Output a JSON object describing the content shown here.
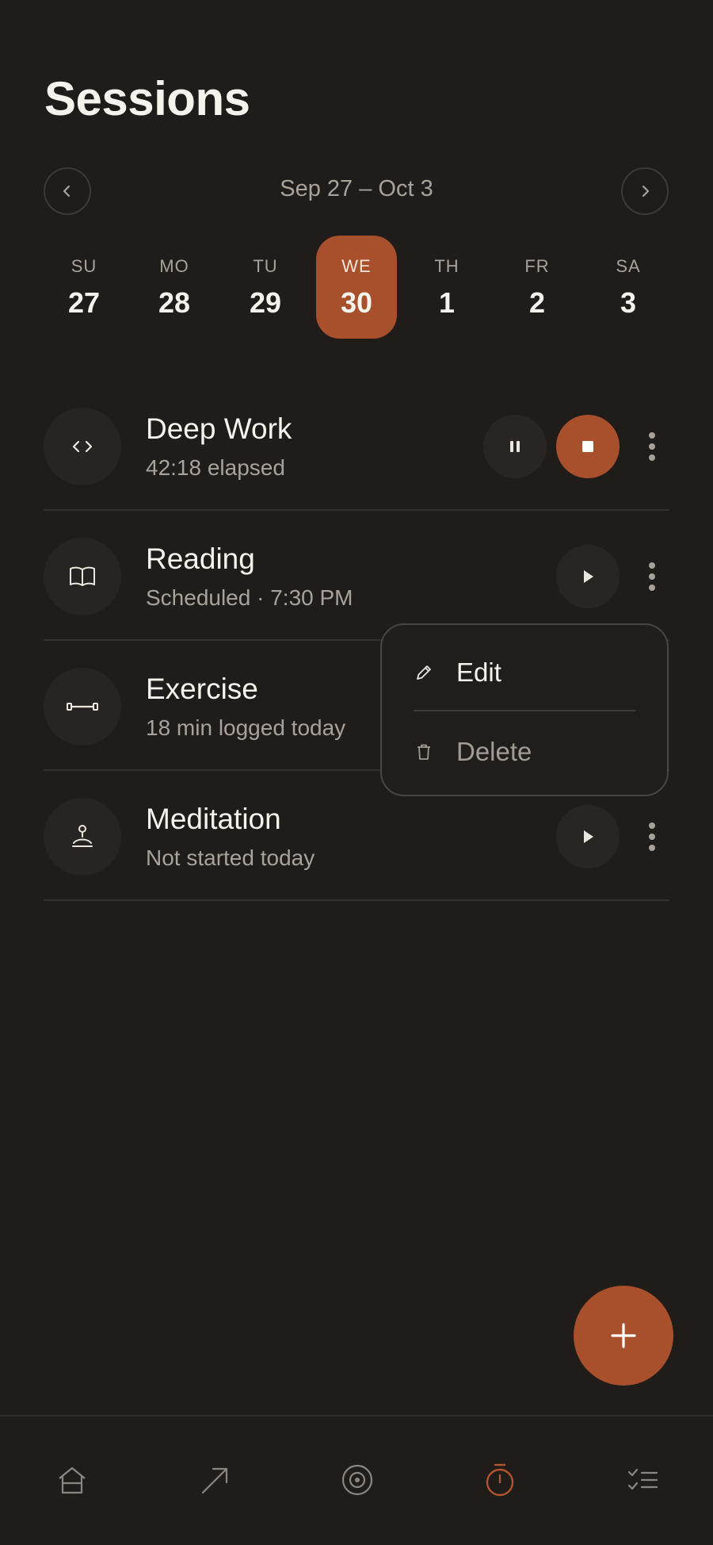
{
  "header": {
    "title": "Sessions"
  },
  "week_nav": {
    "range_label": "Sep 27 – Oct 3"
  },
  "week": {
    "days": [
      {
        "name": "SU",
        "date": "27"
      },
      {
        "name": "MO",
        "date": "28"
      },
      {
        "name": "TU",
        "date": "29"
      },
      {
        "name": "WE",
        "date": "30"
      },
      {
        "name": "TH",
        "date": "1"
      },
      {
        "name": "FR",
        "date": "2"
      },
      {
        "name": "SA",
        "date": "3"
      }
    ],
    "selected_day": "WE"
  },
  "sessions": [
    {
      "title": "Deep Work",
      "subtitle": "42:18 elapsed",
      "icon": "code-icon",
      "state": "running"
    },
    {
      "title": "Reading",
      "subtitle": "Scheduled · 7:30 PM",
      "icon": "book-icon",
      "state": "scheduled"
    },
    {
      "title": "Exercise",
      "subtitle": "18 min logged today",
      "icon": "dumbbell-icon",
      "state": "logged"
    },
    {
      "title": "Meditation",
      "subtitle": "Not started today",
      "icon": "meditation-icon",
      "state": "idle"
    }
  ],
  "context_menu": {
    "edit_label": "Edit",
    "delete_label": "Delete"
  },
  "tabbar": {
    "items": [
      "home-icon",
      "trend-arrow-icon",
      "target-icon",
      "timer-icon",
      "checklist-icon"
    ],
    "active": "timer-icon"
  },
  "colors": {
    "background": "#1f1c1a",
    "accent": "#a84f2c",
    "text_primary": "#f6f2ec",
    "text_secondary": "#a9a29b"
  }
}
